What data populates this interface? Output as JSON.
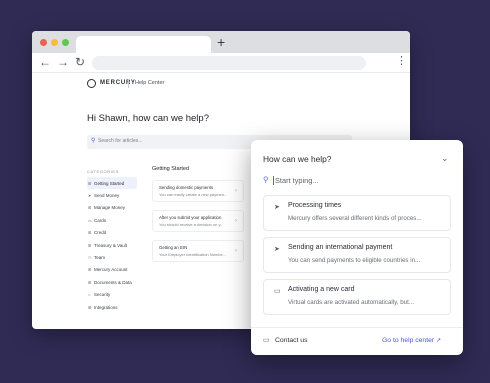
{
  "browser": {
    "new_tab": "+",
    "back": "←",
    "forward": "→",
    "reload": "↻",
    "menu": "⋮"
  },
  "help_page": {
    "brand": "MERCURY",
    "brand_sub": "Help Center",
    "greeting": "Hi Shawn, how can we help?",
    "search_placeholder": "Search for articles...",
    "categories_heading": "CATEGORIES",
    "categories": [
      {
        "icon": "⊞",
        "label": "Getting Started",
        "active": true
      },
      {
        "icon": "➤",
        "label": "Send Money"
      },
      {
        "icon": "⊞",
        "label": "Manage Money"
      },
      {
        "icon": "▭",
        "label": "Cards"
      },
      {
        "icon": "⊞",
        "label": "Credit"
      },
      {
        "icon": "⊞",
        "label": "Treasury & Vault"
      },
      {
        "icon": "⚇",
        "label": "Team"
      },
      {
        "icon": "⊞",
        "label": "Mercury Account"
      },
      {
        "icon": "⊞",
        "label": "Documents & Data"
      },
      {
        "icon": "⌂",
        "label": "Security"
      },
      {
        "icon": "⊞",
        "label": "Integrations"
      }
    ],
    "section_title": "Getting Started",
    "articles": [
      {
        "title": "Sending domestic payments",
        "desc": "You can easily create a new paymen..."
      },
      {
        "title": "After you submit your application",
        "desc": "You should receive a decision on y..."
      },
      {
        "title": "Getting an EIN",
        "desc": "Your Employer Identification Numbe..."
      }
    ]
  },
  "widget": {
    "title": "How can we help?",
    "search_placeholder": "Start typing...",
    "cards": [
      {
        "icon": "➤",
        "title": "Processing times",
        "desc": "Mercury offers several different kinds of proces..."
      },
      {
        "icon": "➤",
        "title": "Sending an international payment",
        "desc": "You can send payments to eligible countries in..."
      },
      {
        "icon": "▭",
        "title": "Activating a new card",
        "desc": "Virtual cards are activated automatically, but..."
      }
    ],
    "contact_label": "Contact us",
    "help_center_label": "Go to help center",
    "ext_icon": "↗"
  }
}
